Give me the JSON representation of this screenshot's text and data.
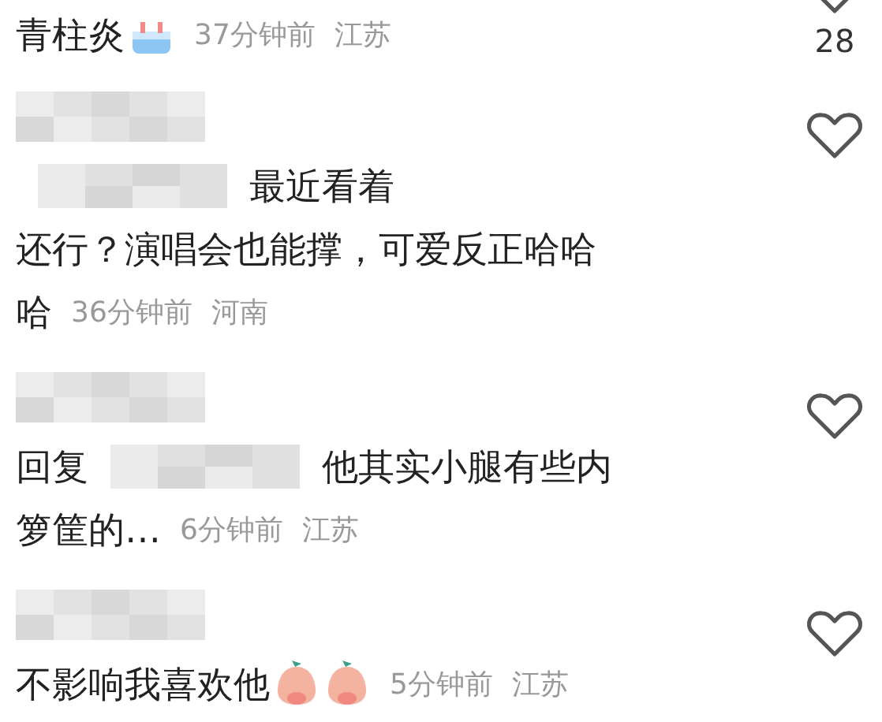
{
  "comments": [
    {
      "likes": "28",
      "lines": [
        [
          {
            "kind": "text",
            "text": "青柱炎"
          },
          {
            "kind": "cake"
          }
        ]
      ],
      "time": "37分钟前",
      "region": "江苏",
      "name_hidden": false
    },
    {
      "lines": [
        [
          {
            "kind": "blur"
          },
          {
            "kind": "text",
            "text": "最近看着"
          }
        ],
        [
          {
            "kind": "text",
            "text": "还行？演唱会也能撑，可爱反正哈哈"
          }
        ],
        [
          {
            "kind": "text",
            "text": "哈"
          }
        ]
      ],
      "time": "36分钟前",
      "region": "河南",
      "name_hidden": true
    },
    {
      "lines": [
        [
          {
            "kind": "text",
            "text": "回复"
          },
          {
            "kind": "blur"
          },
          {
            "kind": "text",
            "text": "他其实小腿有些内"
          }
        ],
        [
          {
            "kind": "text",
            "text": "箩筐的…"
          }
        ]
      ],
      "time": "6分钟前",
      "region": "江苏",
      "name_hidden": true
    },
    {
      "lines": [
        [
          {
            "kind": "text",
            "text": "不影响我喜欢他"
          },
          {
            "kind": "peach"
          },
          {
            "kind": "peach"
          }
        ]
      ],
      "time": "5分钟前",
      "region": "江苏",
      "name_hidden": true
    }
  ]
}
